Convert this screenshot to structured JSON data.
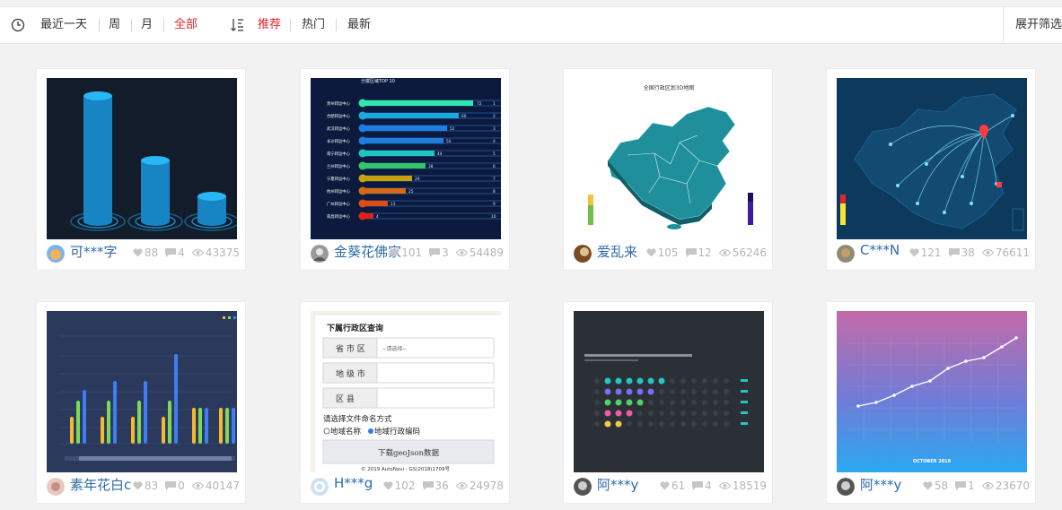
{
  "toolbar": {
    "time_filters": [
      "最近一天",
      "周",
      "月",
      "全部"
    ],
    "active_time": "全部",
    "sort_options": [
      "推荐",
      "热门",
      "最新"
    ],
    "active_sort": "推荐",
    "expand_label": "展开筛选",
    "accent": "#e0252c"
  },
  "cards": [
    {
      "user": "可***字",
      "likes": "88",
      "comments": "4",
      "views": "43375"
    },
    {
      "user": "金葵花佛家",
      "likes": "101",
      "comments": "3",
      "views": "54489",
      "thumb": {
        "title": "分拨区域TOP 10",
        "rows": [
          {
            "label": "贵州转运中心",
            "value": "72",
            "rank": "1"
          },
          {
            "label": "合肥转运中心",
            "value": "60",
            "rank": "2"
          },
          {
            "label": "武汉转运中心",
            "value": "52",
            "rank": "3"
          },
          {
            "label": "长沙转运中心",
            "value": "50",
            "rank": "4"
          },
          {
            "label": "南宁转运中心",
            "value": "44",
            "rank": "5"
          },
          {
            "label": "兰州转运中心",
            "value": "38",
            "rank": "6"
          },
          {
            "label": "宁夏转运中心",
            "value": "29",
            "rank": "7"
          },
          {
            "label": "杭州转运中心",
            "value": "25",
            "rank": "8"
          },
          {
            "label": "广州转运中心",
            "value": "13",
            "rank": "9"
          },
          {
            "label": "南昌转运中心",
            "value": "4",
            "rank": "10"
          }
        ]
      }
    },
    {
      "user": "爱乱来",
      "likes": "105",
      "comments": "12",
      "views": "56246",
      "thumb": {
        "title": "全国行政区划3D地图"
      }
    },
    {
      "user": "C***N",
      "likes": "121",
      "comments": "38",
      "views": "76611"
    },
    {
      "user": "素年花白c",
      "likes": "83",
      "comments": "0",
      "views": "40147"
    },
    {
      "user": "H***g",
      "likes": "102",
      "comments": "36",
      "views": "24978",
      "thumb": {
        "heading": "下属行政区查询",
        "province_label": "省 市 区",
        "province_value": "--请选择--",
        "city_label": "地 级 市",
        "district_label": "区    县",
        "naming_label": "请选择文件命名方式",
        "option_name": "地域名称",
        "option_code": "地域行政编码",
        "download_label": "下载geoJson数据",
        "copyright": "© 2019 AutoNavi - GS(2018)1709号"
      }
    },
    {
      "user": "阿***y",
      "likes": "61",
      "comments": "4",
      "views": "18519"
    },
    {
      "user": "阿***y",
      "likes": "58",
      "comments": "1",
      "views": "23670",
      "thumb": {
        "footer": "OCTOBER 2018"
      }
    }
  ]
}
